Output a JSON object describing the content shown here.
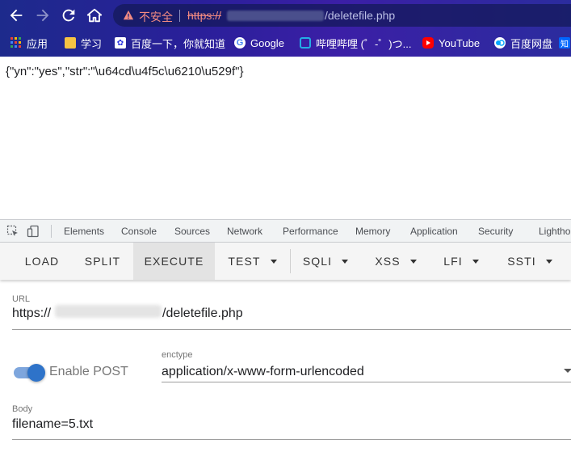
{
  "browser": {
    "insecure_label": "不安全",
    "url_scheme": "https://",
    "url_path": "/deletefile.php",
    "bookmarks": [
      {
        "label": "应用",
        "icon": "apps-grid-icon"
      },
      {
        "label": "学习",
        "icon": "folder-icon"
      },
      {
        "label": "百度一下，你就知道",
        "icon": "baidu-icon"
      },
      {
        "label": "Google",
        "icon": "google-icon"
      },
      {
        "label": "哔哩哔哩 (゜-゜)つ...",
        "icon": "bilibili-icon"
      },
      {
        "label": "YouTube",
        "icon": "youtube-icon"
      },
      {
        "label": "百度网盘",
        "icon": "baidu-netdisk-icon"
      },
      {
        "label": "知",
        "icon": "zhihu-icon"
      }
    ]
  },
  "page": {
    "response_text": "{\"yn\":\"yes\",\"str\":\"\\u64cd\\u4f5c\\u6210\\u529f\"}"
  },
  "devtools": {
    "tabs": [
      "Elements",
      "Console",
      "Sources",
      "Network",
      "Performance",
      "Memory",
      "Application",
      "Security",
      "Lightho"
    ]
  },
  "hackbar": {
    "buttons": [
      "LOAD",
      "SPLIT",
      "EXECUTE",
      "TEST",
      "SQLI",
      "XSS",
      "LFI",
      "SSTI"
    ],
    "active_button": "EXECUTE",
    "url_label": "URL",
    "url_prefix": "https://",
    "url_suffix": "/deletefile.php",
    "enable_post_label": "Enable POST",
    "enable_post_on": true,
    "enctype_label": "enctype",
    "enctype_value": "application/x-www-form-urlencoded",
    "body_label": "Body",
    "body_value": "filename=5.txt"
  },
  "colors": {
    "accent": "#2e73c9",
    "insecure": "#f28b82"
  }
}
